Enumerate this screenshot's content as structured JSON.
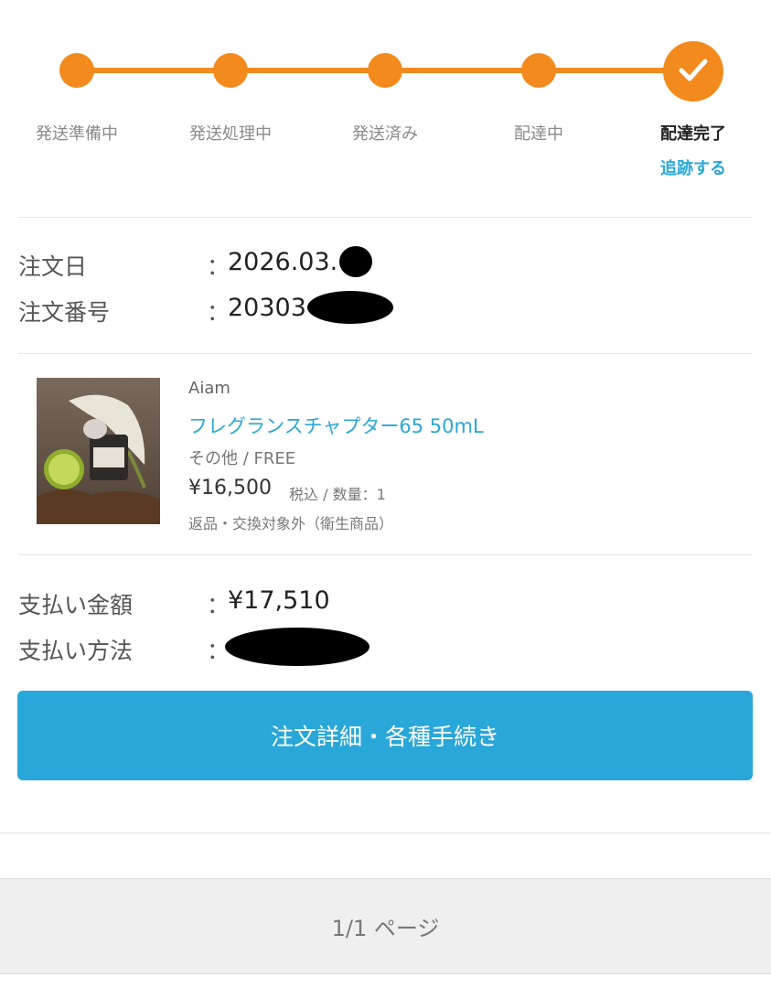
{
  "tracker": {
    "steps": [
      {
        "label": "発送準備中"
      },
      {
        "label": "発送処理中"
      },
      {
        "label": "発送済み"
      },
      {
        "label": "配達中"
      },
      {
        "label": "配達完了"
      }
    ],
    "current_step": 5,
    "track_link": "追跡する"
  },
  "order": {
    "date_label": "注文日",
    "date_colon": "：",
    "date_value": "2026.03.",
    "number_label": "注文番号",
    "number_colon": "：",
    "number_value": "20303"
  },
  "product": {
    "brand": "Aiam",
    "name": "フレグランスチャプター65 50mL",
    "variant": "その他 / FREE",
    "price": "¥16,500",
    "price_note": "税込 / 数量：1",
    "return_note": "返品・交換対象外（衛生商品）"
  },
  "payment": {
    "amount_label": "支払い金額",
    "amount_colon": "：",
    "amount_value": "¥17,510",
    "method_label": "支払い方法",
    "method_colon": "："
  },
  "actions": {
    "detail_button": "注文詳細・各種手続き"
  },
  "pagination": {
    "text": "1/1 ページ"
  },
  "colors": {
    "accent_orange": "#f28a1e",
    "link_blue": "#2aa7d6",
    "button_blue": "#2aa7d9"
  }
}
